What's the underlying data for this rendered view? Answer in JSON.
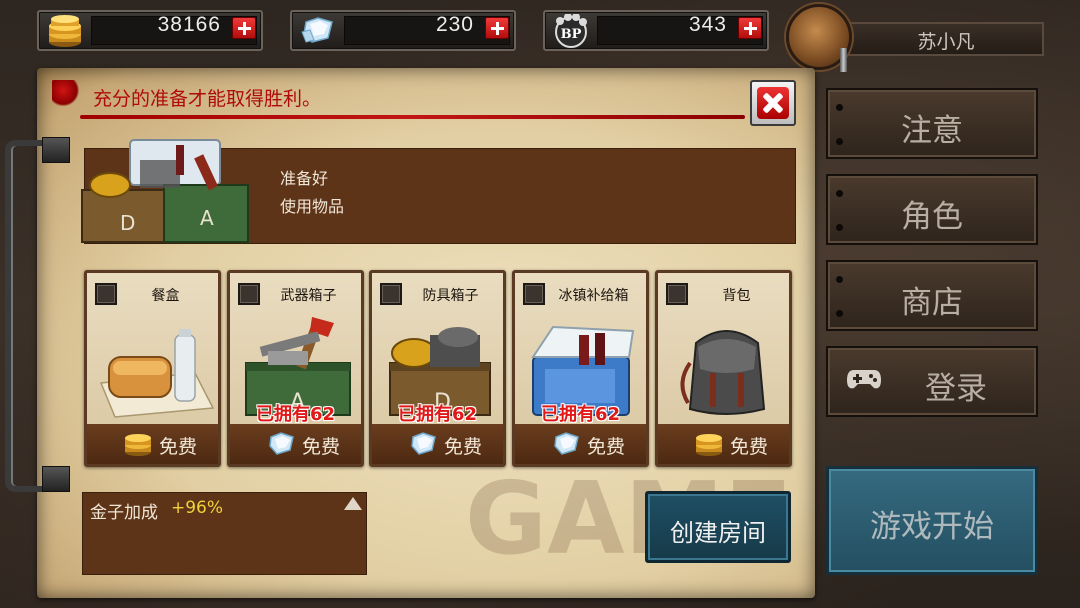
{
  "resources": {
    "gold": {
      "value": "38166",
      "icon": "gold-coin-stack-icon"
    },
    "diamond": {
      "value": "230",
      "icon": "diamond-icon"
    },
    "bp": {
      "value": "343",
      "icon": "bp-paw-icon",
      "badge": "BP"
    }
  },
  "player": {
    "name": "苏小凡"
  },
  "panel": {
    "headline": "充分的准备才能取得胜利。",
    "info": {
      "line1": "准备好",
      "line2": "使用物品"
    },
    "items": [
      {
        "title": "餐盒",
        "owned": "",
        "price": "免费",
        "currency": "gold"
      },
      {
        "title": "武器箱子",
        "owned": "已拥有62",
        "price": "免费",
        "currency": "diamond"
      },
      {
        "title": "防具箱子",
        "owned": "已拥有62",
        "price": "免费",
        "currency": "diamond"
      },
      {
        "title": "冰镇补给箱",
        "owned": "已拥有62",
        "price": "免费",
        "currency": "diamond"
      },
      {
        "title": "背包",
        "owned": "",
        "price": "免费",
        "currency": "gold"
      }
    ],
    "bonus": {
      "label": "金子加成",
      "value": "+96%"
    },
    "create_room": "创建房间"
  },
  "menu": {
    "notice": "注意",
    "character": "角色",
    "shop": "商店",
    "login": "登录",
    "start": "游戏开始"
  },
  "watermark": "GAME",
  "colors": {
    "headline_red": "#b00b0b",
    "owned_red": "#e01818",
    "bonus_yellow": "#f2d13a",
    "start_teal": "#356a80"
  }
}
